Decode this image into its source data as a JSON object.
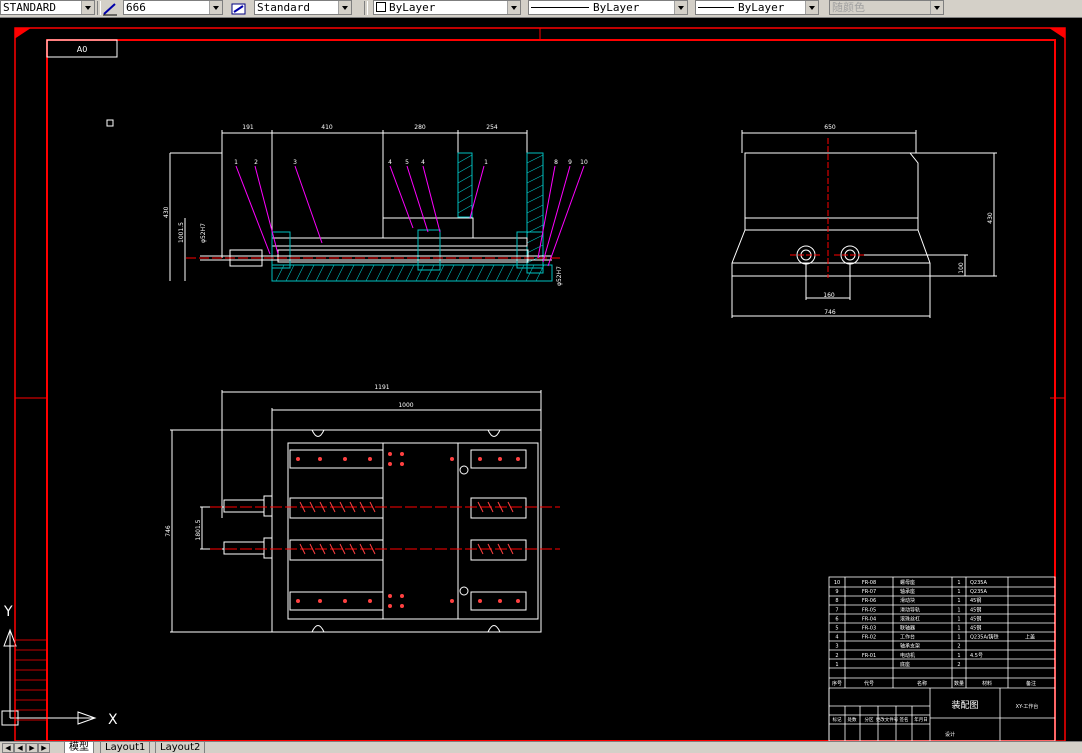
{
  "toolbar": {
    "text_style": "STANDARD",
    "dim_style": "666",
    "table_style": "Standard",
    "layer_color": "ByLayer",
    "linetype": "ByLayer",
    "lineweight": "ByLayer",
    "plot_style": "随颜色"
  },
  "drawing": {
    "sheet_label": "A0",
    "top_view_dims": [
      "191",
      "410",
      "280",
      "254"
    ],
    "top_view_parts": [
      "1",
      "2",
      "3",
      "4",
      "5",
      "4",
      "1",
      "8",
      "9",
      "10"
    ],
    "top_view_vertical": [
      "430",
      "1001.5",
      "φ52H7",
      "φ52H7"
    ],
    "side_view_dims": [
      "650",
      "430",
      "100",
      "160",
      "746"
    ],
    "plan_view_dims": [
      "1191",
      "1000",
      "746",
      "1801.5"
    ],
    "ucs_x": "X",
    "ucs_y": "Y"
  },
  "title_block": {
    "parts_list": [
      {
        "no": "10",
        "code": "FR-08",
        "name": "螺母座",
        "qty": "1",
        "material": "Q235A",
        "note": ""
      },
      {
        "no": "9",
        "code": "FR-07",
        "name": "轴承座",
        "qty": "1",
        "material": "Q235A",
        "note": ""
      },
      {
        "no": "8",
        "code": "FR-06",
        "name": "滑动块",
        "qty": "1",
        "material": "45钢",
        "note": ""
      },
      {
        "no": "7",
        "code": "FR-05",
        "name": "滑动导轨",
        "qty": "1",
        "material": "45钢",
        "note": ""
      },
      {
        "no": "6",
        "code": "FR-04",
        "name": "滚珠丝杠",
        "qty": "1",
        "material": "45钢",
        "note": ""
      },
      {
        "no": "5",
        "code": "FR-03",
        "name": "联轴器",
        "qty": "1",
        "material": "45钢",
        "note": ""
      },
      {
        "no": "4",
        "code": "FR-02",
        "name": "工作台",
        "qty": "1",
        "material": "Q235A/铸铁",
        "note": "上盖"
      },
      {
        "no": "3",
        "code": "",
        "name": "轴承支架",
        "qty": "2",
        "material": "",
        "note": ""
      },
      {
        "no": "2",
        "code": "FR-01",
        "name": "电动机",
        "qty": "1",
        "material": "4.5号",
        "note": ""
      },
      {
        "no": "1",
        "code": "",
        "name": "底座",
        "qty": "2",
        "material": "",
        "note": ""
      }
    ],
    "header": [
      "序号",
      "代号",
      "名称",
      "数量",
      "材料",
      "备注"
    ],
    "drawing_title": "装配图",
    "sign_row": [
      "标记",
      "处数",
      "分区",
      "更改文件号",
      "签名",
      "年月日"
    ],
    "footer_left": "设计",
    "footer_right": "XY-工作台"
  },
  "layout_tabs": [
    "模型",
    "Layout1",
    "Layout2"
  ],
  "nav_buttons": [
    "◀",
    "◀",
    "▶",
    "▶"
  ],
  "colors": {
    "background": "#000000",
    "border": "#ff0000",
    "geometry": "#ffffff",
    "leader": "#ff00ff",
    "hatch": "#00c0c0",
    "center": "#ff0000"
  }
}
